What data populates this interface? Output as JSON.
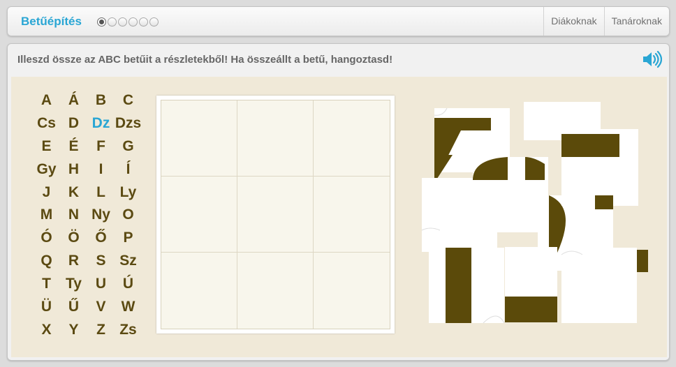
{
  "header": {
    "title": "Betűépítés",
    "progress": {
      "current": 1,
      "total": 6
    },
    "nav": [
      "Diákoknak",
      "Tanároknak"
    ]
  },
  "instruction": "Illeszd össze az ABC betűit a részletekből! Ha összeállt a betű, hangoztasd!",
  "speaker_icon": "speaker-icon",
  "alphabet": [
    "A",
    "Á",
    "B",
    "C",
    "Cs",
    "D",
    "Dz",
    "Dzs",
    "E",
    "É",
    "F",
    "G",
    "Gy",
    "H",
    "I",
    "Í",
    "J",
    "K",
    "L",
    "Ly",
    "M",
    "N",
    "Ny",
    "O",
    "Ó",
    "Ö",
    "Ő",
    "P",
    "Q",
    "R",
    "S",
    "Sz",
    "T",
    "Ty",
    "U",
    "Ú",
    "Ü",
    "Ű",
    "V",
    "W",
    "X",
    "Y",
    "Z",
    "Zs"
  ],
  "selected_letter": "Dz",
  "puzzle": {
    "grid_rows": 3,
    "grid_cols": 3,
    "pieces_count": 9
  },
  "colors": {
    "accent": "#2aa6d4",
    "letter": "#5b4a12",
    "piece_fill": "#5b4a0a",
    "work_bg": "#f0e9d8"
  }
}
